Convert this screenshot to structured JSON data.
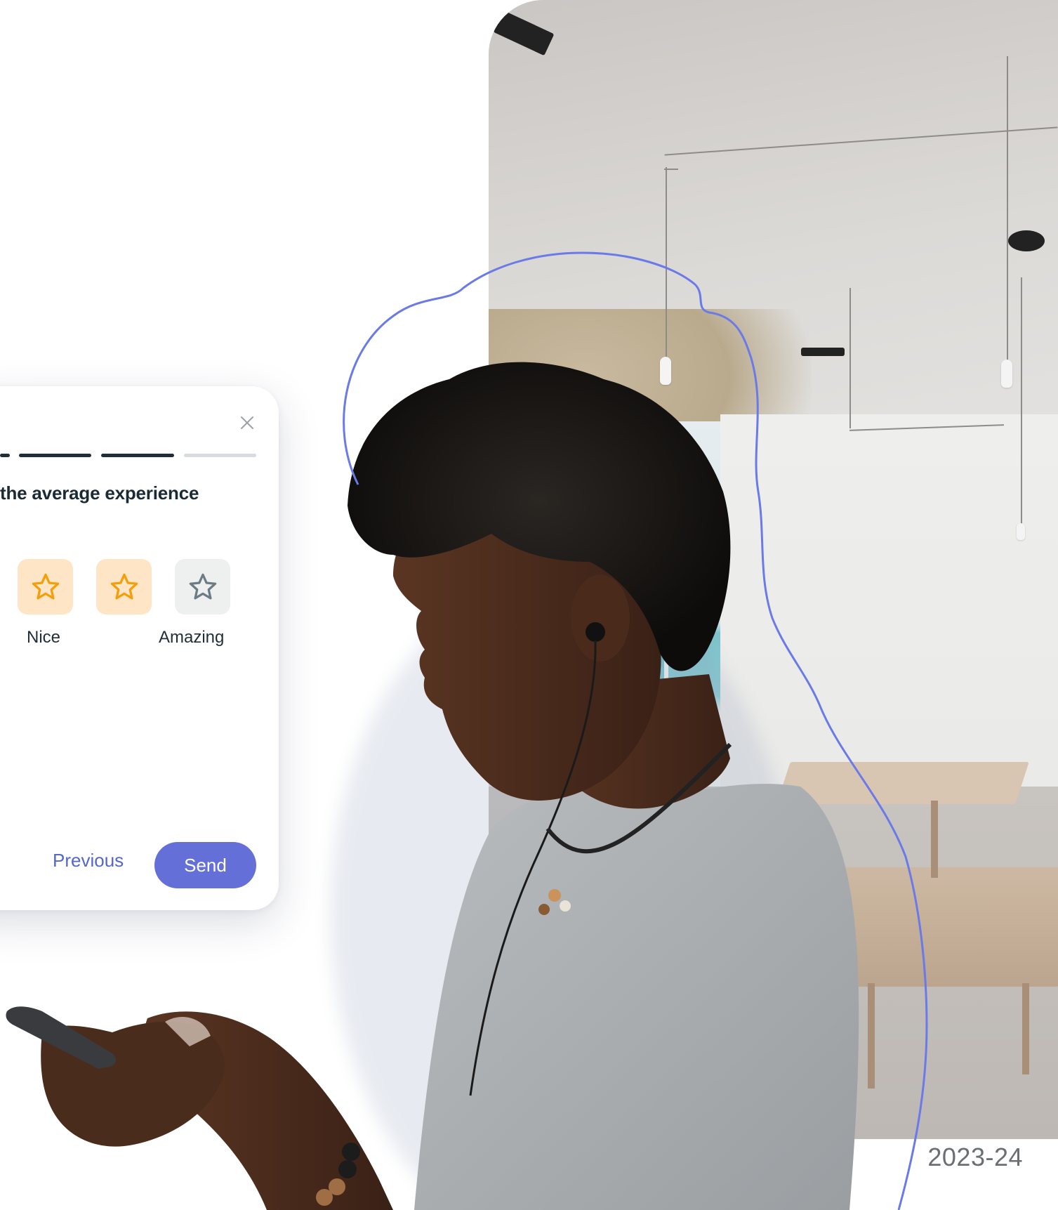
{
  "survey": {
    "question": "the average experience",
    "progress": {
      "completed_segments": 3,
      "total_segments": 4
    },
    "rating": {
      "value": 4,
      "max": 5,
      "visible_stars": [
        {
          "state": "filled",
          "icon": "star-icon"
        },
        {
          "state": "filled",
          "icon": "star-icon"
        },
        {
          "state": "empty",
          "icon": "star-outline-icon"
        }
      ],
      "labels": {
        "mid": "Nice",
        "high": "Amazing"
      }
    },
    "actions": {
      "previous_label": "Previous",
      "send_label": "Send"
    },
    "close_icon": "close-icon"
  },
  "photo": {
    "year_label": "2023-24"
  },
  "colors": {
    "accent": "#6470d8",
    "link": "#5566cc",
    "star_filled_bg": "#fde5c6",
    "star_filled_stroke": "#f59e0b",
    "star_empty_bg": "#eef0f0",
    "star_empty_stroke": "#6b7c85",
    "heading": "#1a2b35",
    "squiggle": "#6a7ae8"
  }
}
